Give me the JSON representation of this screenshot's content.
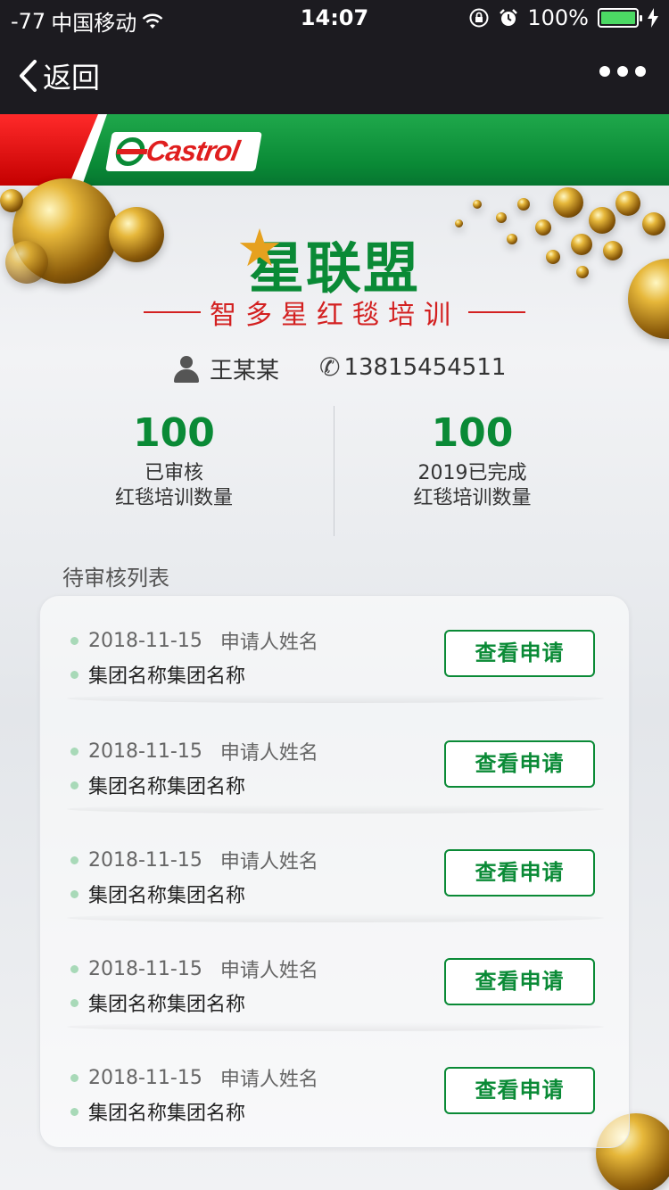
{
  "status_bar": {
    "signal": "-77",
    "carrier": "中国移动",
    "time": "14:07",
    "battery": "100%",
    "battery_level": 1.0
  },
  "nav": {
    "back_label": "返回"
  },
  "brand": {
    "logo_text": "Castrol",
    "colors": {
      "green": "#0a8a36",
      "red": "#e01e1e"
    }
  },
  "header": {
    "title": "星联盟",
    "subtitle": "智多星红毯培训"
  },
  "user": {
    "name": "王某某",
    "phone": "13815454511"
  },
  "stats": [
    {
      "value": "100",
      "label_line1": "已审核",
      "label_line2": "红毯培训数量"
    },
    {
      "value": "100",
      "label_line1": "2019已完成",
      "label_line2": "红毯培训数量"
    }
  ],
  "pending": {
    "section_title": "待审核列表",
    "button_label": "查看申请",
    "items": [
      {
        "date": "2018-11-15",
        "applicant": "申请人姓名",
        "group": "集团名称集团名称"
      },
      {
        "date": "2018-11-15",
        "applicant": "申请人姓名",
        "group": "集团名称集团名称"
      },
      {
        "date": "2018-11-15",
        "applicant": "申请人姓名",
        "group": "集团名称集团名称"
      },
      {
        "date": "2018-11-15",
        "applicant": "申请人姓名",
        "group": "集团名称集团名称"
      },
      {
        "date": "2018-11-15",
        "applicant": "申请人姓名",
        "group": "集团名称集团名称"
      }
    ]
  },
  "icons": {
    "wifi": "wifi-icon",
    "lock": "orientation-lock-icon",
    "alarm": "alarm-icon",
    "charging": "charging-icon",
    "back": "chevron-left-icon",
    "more": "more-dots-icon",
    "person": "person-icon",
    "phone": "phone-icon"
  }
}
